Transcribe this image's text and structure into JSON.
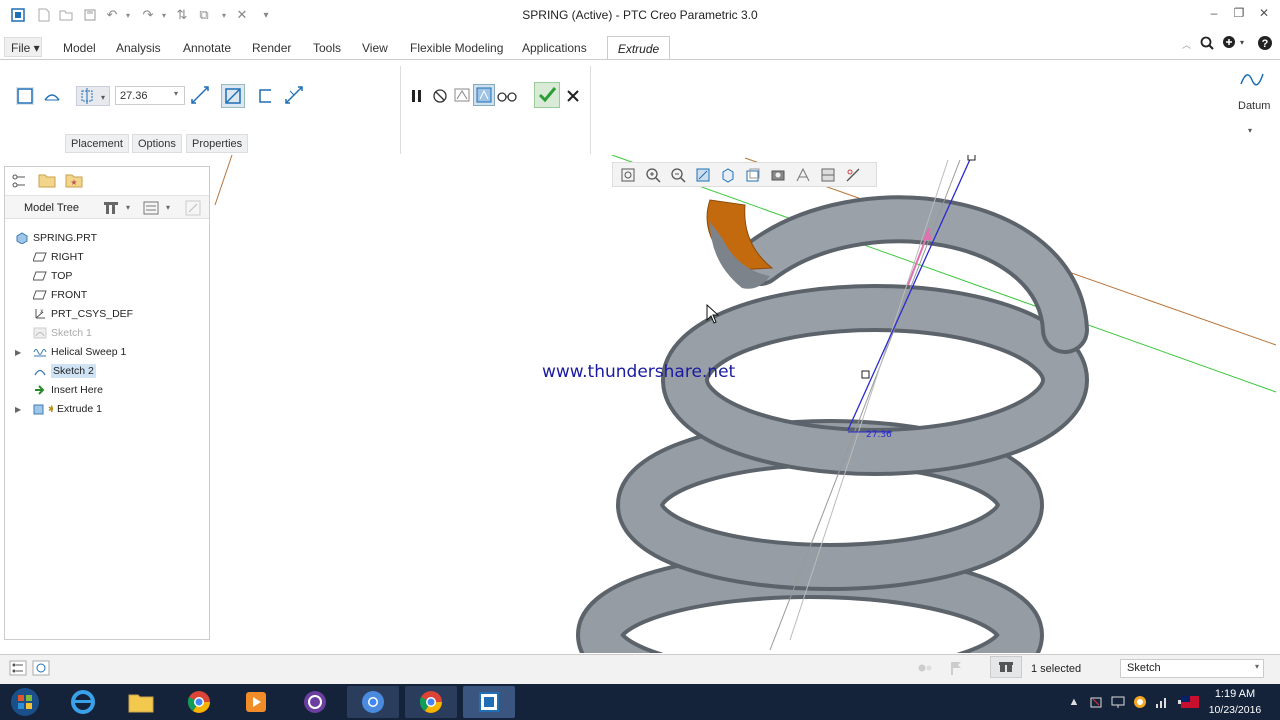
{
  "window": {
    "title": "SPRING (Active) - PTC Creo Parametric 3.0"
  },
  "menu": {
    "file": "File ▾",
    "items": [
      "Model",
      "Analysis",
      "Annotate",
      "Render",
      "Tools",
      "View",
      "Flexible Modeling",
      "Applications"
    ],
    "active_tab": "Extrude"
  },
  "ribbon": {
    "depth_value": "27.36",
    "subtabs": [
      "Placement",
      "Options",
      "Properties"
    ],
    "datum_label": "Datum"
  },
  "model_tree": {
    "header": "Model Tree",
    "items": [
      {
        "label": "SPRING.PRT",
        "icon": "part-icon",
        "dim": false,
        "selected": false
      },
      {
        "label": "RIGHT",
        "icon": "datum-plane-icon",
        "dim": false,
        "selected": false
      },
      {
        "label": "TOP",
        "icon": "datum-plane-icon",
        "dim": false,
        "selected": false
      },
      {
        "label": "FRONT",
        "icon": "datum-plane-icon",
        "dim": false,
        "selected": false
      },
      {
        "label": "PRT_CSYS_DEF",
        "icon": "csys-icon",
        "dim": false,
        "selected": false
      },
      {
        "label": "Sketch 1",
        "icon": "sketch-icon",
        "dim": true,
        "selected": false
      },
      {
        "label": "Helical Sweep 1",
        "icon": "helical-sweep-icon",
        "dim": false,
        "selected": false
      },
      {
        "label": "Sketch 2",
        "icon": "sketch-icon",
        "dim": false,
        "selected": true
      },
      {
        "label": "Insert Here",
        "icon": "insert-arrow-icon",
        "dim": false,
        "selected": false
      },
      {
        "label": "Extrude 1",
        "icon": "extrude-icon",
        "dim": false,
        "selected": false
      }
    ]
  },
  "viewport": {
    "watermark": "www.thundershare.net",
    "dimension_label": "27.36"
  },
  "status": {
    "selected": "1 selected",
    "filter": "Sketch"
  },
  "taskbar": {
    "time": "1:19 AM",
    "date": "10/23/2016"
  },
  "colors": {
    "accent_blue": "#1f6fb5",
    "spring_gray": "#8a9199",
    "orange_section": "#c46a0e",
    "taskbar_bg": "#14233a"
  }
}
